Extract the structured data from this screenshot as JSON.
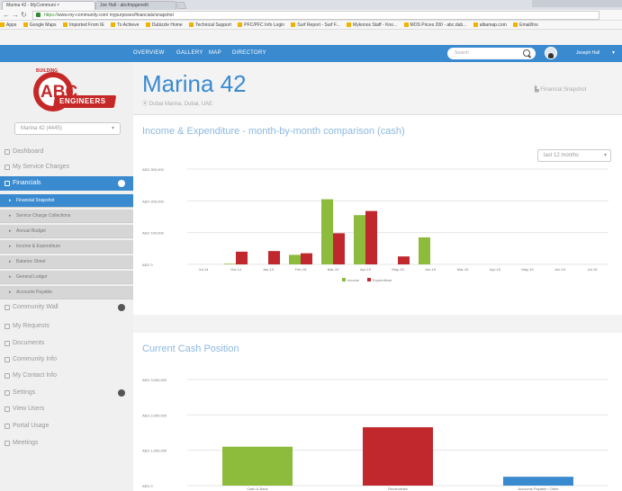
{
  "browser": {
    "tabs": [
      {
        "label": "Marina 42 - MyCommuni ×"
      },
      {
        "label": "Joe Hall - abcfmpgeneth"
      }
    ],
    "url_secure": "https://",
    "url_rest": "www.my-community.com/ mypurposes/financials/snapshot",
    "bookmarks": [
      "Apps",
      "Google Maps",
      "Imported From IE",
      "To Achieve",
      "Dubizzle Home",
      "Technical Support",
      "PFC/PFC Info Login",
      "Surf Report - Surf F...",
      "Mykonos Staff - Kno...",
      "MOS Prices 200 - abc.dub...",
      "albamap.com",
      "Email/Ins"
    ]
  },
  "topnav": {
    "links": [
      "OVERVIEW",
      "GALLERY",
      "MAP",
      "DIRECTORY"
    ],
    "search_placeholder": "Search",
    "username": "Joseph Hall",
    "caret": "▾"
  },
  "logo": {
    "letters": "ABC",
    "ribbon": "ENGINEERS",
    "arc": "BUILDING"
  },
  "sidebar": {
    "building_select": "Marina 42 (4445)",
    "items": [
      {
        "label": "Dashboard"
      },
      {
        "label": "My Service Charges"
      },
      {
        "label": "Financials"
      },
      {
        "label": "Community Wall"
      },
      {
        "label": "My Requests"
      },
      {
        "label": "Documents"
      },
      {
        "label": "Community Info"
      },
      {
        "label": "My Contact Info"
      },
      {
        "label": "Settings"
      },
      {
        "label": "View Users"
      },
      {
        "label": "Portal Usage"
      },
      {
        "label": "Meetings"
      }
    ],
    "subitems": [
      {
        "label": "Financial Snapshot"
      },
      {
        "label": "Service Charge Collections"
      },
      {
        "label": "Annual Budget"
      },
      {
        "label": "Income & Expenditure"
      },
      {
        "label": "Balance Sheet"
      },
      {
        "label": "General Ledger"
      },
      {
        "label": "Accounts Payable"
      }
    ]
  },
  "page": {
    "title": "Marina 42",
    "subtitle": "Dubai Marina, Dubai, UAE",
    "financial_link": "Financial Snapshot"
  },
  "chart1": {
    "title": "Income & Expenditure - month-by-month comparison (cash)",
    "range_select": "last 12 months",
    "colors": {
      "income": "#8dbb3c",
      "expenditure": "#c0282d"
    }
  },
  "chart2": {
    "title": "Current Cash Position"
  },
  "chart_data": [
    {
      "type": "bar",
      "title": "Income & Expenditure - month-by-month comparison (cash)",
      "categories": [
        "Jul-14",
        "Oct-14",
        "Jan-15",
        "Feb-15",
        "Mar-15",
        "Apr-15",
        "May-15",
        "Jun-15",
        "Mar-15",
        "Apr-15",
        "May-15",
        "Jun-15",
        "Jul-15"
      ],
      "series": [
        {
          "name": "Income",
          "values": [
            0,
            2000,
            0,
            30000,
            205000,
            155000,
            0,
            85000,
            0,
            0,
            0,
            0,
            0
          ]
        },
        {
          "name": "Expenditure",
          "values": [
            0,
            40000,
            42000,
            35000,
            98000,
            168000,
            25000,
            0,
            0,
            0,
            0,
            0,
            0
          ]
        }
      ],
      "yticks": [
        "AED 300,000",
        "AED 200,000",
        "AED 100,000",
        "AED 0"
      ],
      "ylim": [
        0,
        300000
      ],
      "legend": "bottom"
    },
    {
      "type": "bar",
      "title": "Current Cash Position",
      "categories": [
        "Cash & Bank",
        "Receivables",
        "Accounts Payable / Other"
      ],
      "values": [
        1100000,
        1650000,
        250000
      ],
      "colors": [
        "#8dbb3c",
        "#c0282d",
        "#3a8ad0"
      ],
      "yticks": [
        "AED 3,000,000",
        "AED 2,000,000",
        "AED 1,000,000",
        "AED 0"
      ],
      "ylim": [
        0,
        3000000
      ]
    }
  ]
}
